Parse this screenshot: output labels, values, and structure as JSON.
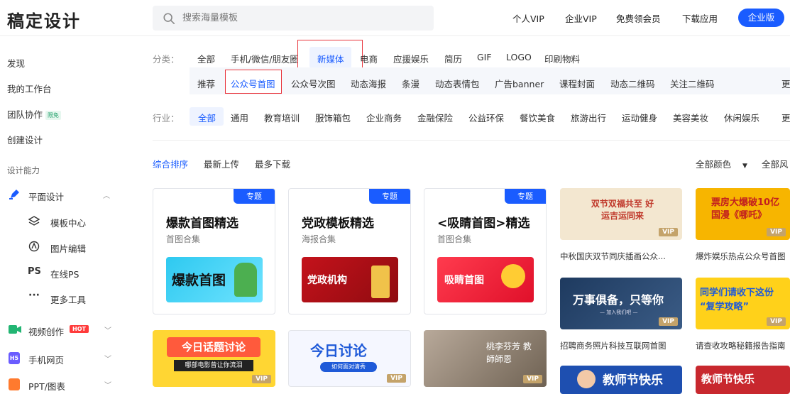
{
  "brand": {
    "logo": "稿定设计"
  },
  "search": {
    "placeholder": "搜索海量模板"
  },
  "topnav": [
    "个人VIP",
    "企业VIP",
    "免费领会员",
    "下载应用"
  ],
  "enterprise_button": "企业版",
  "sidebar": {
    "items": [
      "发现",
      "我的工作台",
      "团队协作",
      "创建设计"
    ],
    "team_badge": "限免",
    "section_label": "设计能力",
    "flat_design": "平面设计",
    "flat_sub": [
      "模板中心",
      "图片编辑",
      "在线PS",
      "更多工具"
    ],
    "ps_glyph": "PS",
    "video": "视频创作",
    "hot": "HOT",
    "mobile": "手机网页",
    "h5": "H5",
    "ppt": "PPT/图表"
  },
  "category": {
    "label": "分类：",
    "items": [
      "全部",
      "手机/微信/朋友圈",
      "新媒体",
      "电商",
      "应援娱乐",
      "简历",
      "GIF",
      "LOGO",
      "印刷物料"
    ]
  },
  "subcategory": {
    "items": [
      "推荐",
      "公众号首图",
      "公众号次图",
      "动态海报",
      "条漫",
      "动态表情包",
      "广告banner",
      "课程封面",
      "动态二维码",
      "关注二维码"
    ],
    "more": "更"
  },
  "industry": {
    "label": "行业：",
    "items": [
      "全部",
      "通用",
      "教育培训",
      "服饰箱包",
      "企业商务",
      "金融保险",
      "公益环保",
      "餐饮美食",
      "旅游出行",
      "运动健身",
      "美容美妆",
      "休闲娱乐"
    ],
    "more": "更"
  },
  "sort": {
    "items": [
      "综合排序",
      "最新上传",
      "最多下载"
    ],
    "color_filter": "全部颜色",
    "style_filter": "全部风"
  },
  "cards": [
    {
      "tag": "专题",
      "title": "爆款首图精选",
      "subtitle": "首图合集",
      "art": "爆款首图"
    },
    {
      "tag": "专题",
      "title": "党政模板精选",
      "subtitle": "海报合集",
      "art": "党政机构"
    },
    {
      "tag": "专题",
      "title": "<吸睛首图>精选",
      "subtitle": "首图合集",
      "art": "吸睛首图"
    }
  ],
  "bottom_thumbs": [
    {
      "title": "今日话题讨论",
      "sub": "哪部电影曾让你流泪",
      "vip": "VIP"
    },
    {
      "title": "今日讨论",
      "sub": "如何面对清秀",
      "vip": "VIP"
    },
    {
      "title": "桃李芬芳 教師師恩",
      "sub": "",
      "vip": "VIP"
    }
  ],
  "right_thumbs": [
    {
      "art": "双节双福共至 好运吉运同来",
      "caption": "中秋国庆双节同庆插画公众...",
      "vip": "VIP"
    },
    {
      "art": "票房大爆破10亿 国漫《哪吒》",
      "caption": "爆炸娱乐热点公众号首图",
      "vip": "VIP"
    },
    {
      "art": "万事俱备，只等你",
      "art_sub": "— 加入我们吧 —",
      "caption": "招聘商务照片科技互联网首图",
      "vip": "VIP"
    },
    {
      "art": "同学们请收下这份 “复学攻略”",
      "caption": "请查收攻略秘籍报告指南",
      "vip": "VIP"
    },
    {
      "art": "教师节快乐",
      "caption": ""
    },
    {
      "art": "教师节快乐",
      "caption": ""
    }
  ],
  "colors": {
    "brand_blue": "#1a5cff",
    "highlight_red": "#e8343b",
    "vip_gold": "#c4a36a"
  }
}
